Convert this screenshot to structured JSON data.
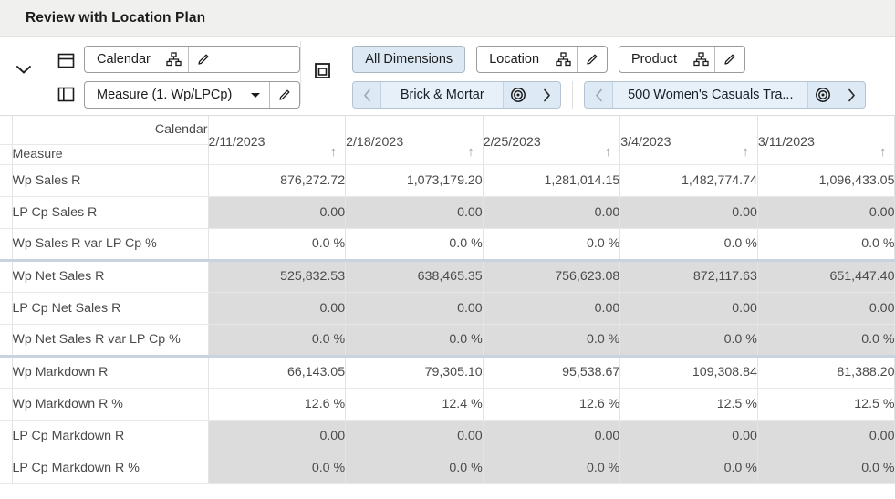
{
  "titlebar": {
    "title": "Review with Location Plan"
  },
  "toolbar": {
    "collapse_icon": "chevron-down-icon",
    "row_layout_icon": "horizontal-split-icon",
    "col_layout_icon": "vertical-split-icon",
    "panel_icon": "panel-frame-icon",
    "calendar_field": {
      "label": "Calendar",
      "hierarchy_icon": "hierarchy-icon",
      "edit_icon": "pencil-icon"
    },
    "measure_field": {
      "label": "Measure (1. Wp/LPCp)",
      "dropdown_icon": "chevron-down-icon",
      "edit_icon": "pencil-icon"
    },
    "all_dimensions_button": "All Dimensions",
    "location_field": {
      "label": "Location",
      "hierarchy_icon": "hierarchy-icon",
      "edit_icon": "pencil-icon"
    },
    "product_field": {
      "label": "Product",
      "hierarchy_icon": "hierarchy-icon",
      "edit_icon": "pencil-icon"
    },
    "location_nav": {
      "prev_icon": "chevron-left-icon",
      "value": "Brick & Mortar",
      "target_icon": "target-icon",
      "next_icon": "chevron-right-icon"
    },
    "product_nav": {
      "prev_icon": "chevron-left-icon",
      "value": "500 Women's Casuals Tra...",
      "target_icon": "target-icon",
      "next_icon": "chevron-right-icon"
    }
  },
  "grid": {
    "calendar_header": "Calendar",
    "measure_header": "Measure",
    "sort_arrow": "↑",
    "columns": [
      "2/11/2023",
      "2/18/2023",
      "2/25/2023",
      "3/4/2023",
      "3/11/2023"
    ],
    "rows": [
      {
        "label": "Wp Sales R",
        "shade": false,
        "group_start": false,
        "values": [
          "876,272.72",
          "1,073,179.20",
          "1,281,014.15",
          "1,482,774.74",
          "1,096,433.05"
        ]
      },
      {
        "label": "LP Cp Sales R",
        "shade": true,
        "group_start": false,
        "values": [
          "0.00",
          "0.00",
          "0.00",
          "0.00",
          "0.00"
        ]
      },
      {
        "label": "Wp Sales R var LP Cp %",
        "shade": false,
        "group_start": false,
        "values": [
          "0.0 %",
          "0.0 %",
          "0.0 %",
          "0.0 %",
          "0.0 %"
        ]
      },
      {
        "label": "Wp Net Sales R",
        "shade": true,
        "group_start": true,
        "values": [
          "525,832.53",
          "638,465.35",
          "756,623.08",
          "872,117.63",
          "651,447.40"
        ]
      },
      {
        "label": "LP Cp Net Sales R",
        "shade": true,
        "group_start": false,
        "values": [
          "0.00",
          "0.00",
          "0.00",
          "0.00",
          "0.00"
        ]
      },
      {
        "label": "Wp Net Sales R var LP Cp %",
        "shade": true,
        "group_start": false,
        "values": [
          "0.0 %",
          "0.0 %",
          "0.0 %",
          "0.0 %",
          "0.0 %"
        ]
      },
      {
        "label": "Wp Markdown R",
        "shade": false,
        "group_start": true,
        "values": [
          "66,143.05",
          "79,305.10",
          "95,538.67",
          "109,308.84",
          "81,388.20"
        ]
      },
      {
        "label": "Wp Markdown R %",
        "shade": false,
        "group_start": false,
        "values": [
          "12.6 %",
          "12.4 %",
          "12.6 %",
          "12.5 %",
          "12.5 %"
        ]
      },
      {
        "label": "LP Cp Markdown R",
        "shade": true,
        "group_start": false,
        "values": [
          "0.00",
          "0.00",
          "0.00",
          "0.00",
          "0.00"
        ]
      },
      {
        "label": "LP Cp Markdown R %",
        "shade": true,
        "group_start": false,
        "values": [
          "0.0 %",
          "0.0 %",
          "0.0 %",
          "0.0 %",
          "0.0 %"
        ]
      }
    ]
  },
  "colors": {
    "titlebar_bg": "#f0f0ef",
    "accent_button_bg": "#dce9f5",
    "nav_pill_bg": "#dde9f4",
    "shaded_row_bg": "#dcdcdc",
    "group_separator": "#c8d3de",
    "sort_arrow": "#9aa79a"
  }
}
